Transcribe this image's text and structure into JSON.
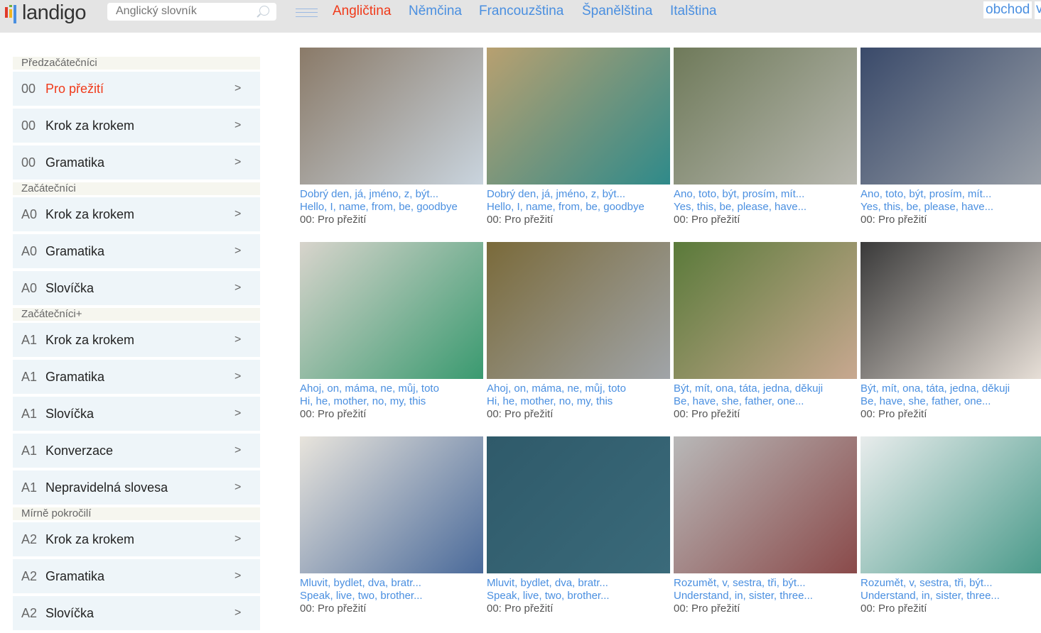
{
  "header": {
    "logo": "landigo",
    "logo_colors": [
      "#e03a2a",
      "#f2b51d",
      "#6fae3a",
      "#4a8fe0"
    ],
    "search": {
      "placeholder": "Anglický slovník",
      "value": ""
    },
    "nav": [
      {
        "label": "Angličtina",
        "active": true
      },
      {
        "label": "Němčina"
      },
      {
        "label": "Francouzština"
      },
      {
        "label": "Španělština"
      },
      {
        "label": "Italština"
      }
    ],
    "shop": "obchod",
    "shop_cut": "v"
  },
  "sidebar": [
    {
      "section": "Předzačátečníci",
      "items": [
        {
          "code": "00",
          "label": "Pro přežití",
          "active": true
        },
        {
          "code": "00",
          "label": "Krok za krokem"
        },
        {
          "code": "00",
          "label": "Gramatika"
        }
      ]
    },
    {
      "section": "Začátečníci",
      "items": [
        {
          "code": "A0",
          "label": "Krok za krokem"
        },
        {
          "code": "A0",
          "label": "Gramatika"
        },
        {
          "code": "A0",
          "label": "Slovíčka"
        }
      ]
    },
    {
      "section": "Začátečníci+",
      "items": [
        {
          "code": "A1",
          "label": "Krok za krokem"
        },
        {
          "code": "A1",
          "label": "Gramatika"
        },
        {
          "code": "A1",
          "label": "Slovíčka"
        },
        {
          "code": "A1",
          "label": "Konverzace"
        },
        {
          "code": "A1",
          "label": "Nepravidelná slovesa"
        }
      ]
    },
    {
      "section": "Mírně pokročilí",
      "items": [
        {
          "code": "A2",
          "label": "Krok za krokem"
        },
        {
          "code": "A2",
          "label": "Gramatika"
        },
        {
          "code": "A2",
          "label": "Slovíčka"
        }
      ]
    }
  ],
  "arrow": ">",
  "cards": [
    {
      "cz": "Dobrý den, já, jméno, z, být...",
      "en": "Hello, I, name, from, be, goodbye",
      "course": "00: Pro přežití",
      "colors": [
        "#8a7a68",
        "#c9d4de"
      ]
    },
    {
      "cz": "Dobrý den, já, jméno, z, být...",
      "en": "Hello, I, name, from, be, goodbye",
      "course": "00: Pro přežití",
      "colors": [
        "#b8a070",
        "#2f8a8a"
      ]
    },
    {
      "cz": "Ano, toto, být, prosím, mít...",
      "en": "Yes, this, be, please, have...",
      "course": "00: Pro přežití",
      "colors": [
        "#6f7a5a",
        "#b8b8b0"
      ]
    },
    {
      "cz": "Ano, toto, být, prosím, mít...",
      "en": "Yes, this, be, please, have...",
      "course": "00: Pro přežití",
      "colors": [
        "#3a4a6a",
        "#9aa0a8"
      ]
    },
    {
      "cz": "Ahoj, on, máma, ne, můj, toto",
      "en": "Hi, he, mother, no, my, this",
      "course": "00: Pro přežití",
      "colors": [
        "#d8d4cc",
        "#3a9a70"
      ]
    },
    {
      "cz": "Ahoj, on, máma, ne, můj, toto",
      "en": "Hi, he, mother, no, my, this",
      "course": "00: Pro přežití",
      "colors": [
        "#7a6a3a",
        "#a0a4a8"
      ]
    },
    {
      "cz": "Být, mít, ona, táta, jedna, děkuji",
      "en": "Be, have, she, father, one...",
      "course": "00: Pro přežití",
      "colors": [
        "#5a7a3a",
        "#c8a890"
      ]
    },
    {
      "cz": "Být, mít, ona, táta, jedna, děkuji",
      "en": "Be, have, she, father, one...",
      "course": "00: Pro přežití",
      "colors": [
        "#3a3a3a",
        "#e8e0d8"
      ]
    },
    {
      "cz": "Mluvit, bydlet, dva, bratr...",
      "en": "Speak, live, two, brother...",
      "course": "00: Pro přežití",
      "colors": [
        "#e8e4dc",
        "#4a6a9a"
      ]
    },
    {
      "cz": "Mluvit, bydlet, dva, bratr...",
      "en": "Speak, live, two, brother...",
      "course": "00: Pro přežití",
      "colors": [
        "#2f5a6a",
        "#3a6a7a"
      ]
    },
    {
      "cz": "Rozumět, v, sestra, tři, být...",
      "en": "Understand, in, sister, three...",
      "course": "00: Pro přežití",
      "colors": [
        "#b8b8b8",
        "#8a4a4a"
      ]
    },
    {
      "cz": "Rozumět, v, sestra, tři, být...",
      "en": "Understand, in, sister, three...",
      "course": "00: Pro přežití",
      "colors": [
        "#e8ecec",
        "#4a9a8a"
      ]
    }
  ]
}
